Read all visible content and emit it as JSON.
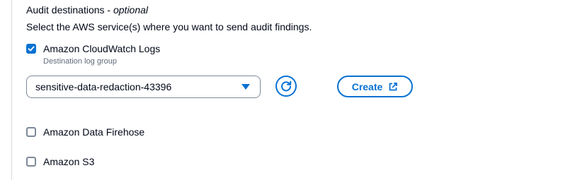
{
  "section": {
    "title": "Audit destinations",
    "title_separator": " - ",
    "title_optional": "optional",
    "description": "Select the AWS service(s) where you want to send audit findings."
  },
  "destinations": {
    "cloudwatch": {
      "label": "Amazon CloudWatch Logs",
      "checked": true,
      "log_group_label": "Destination log group",
      "log_group_value": "sensitive-data-redaction-43396",
      "refresh_icon": "refresh-icon",
      "create_label": "Create",
      "create_icon": "external-link-icon"
    },
    "firehose": {
      "label": "Amazon Data Firehose",
      "checked": false
    },
    "s3": {
      "label": "Amazon S3",
      "checked": false
    }
  },
  "colors": {
    "accent": "#0972d3",
    "text": "#000716",
    "secondary_text": "#5f6b7a",
    "border": "#7d8998"
  }
}
